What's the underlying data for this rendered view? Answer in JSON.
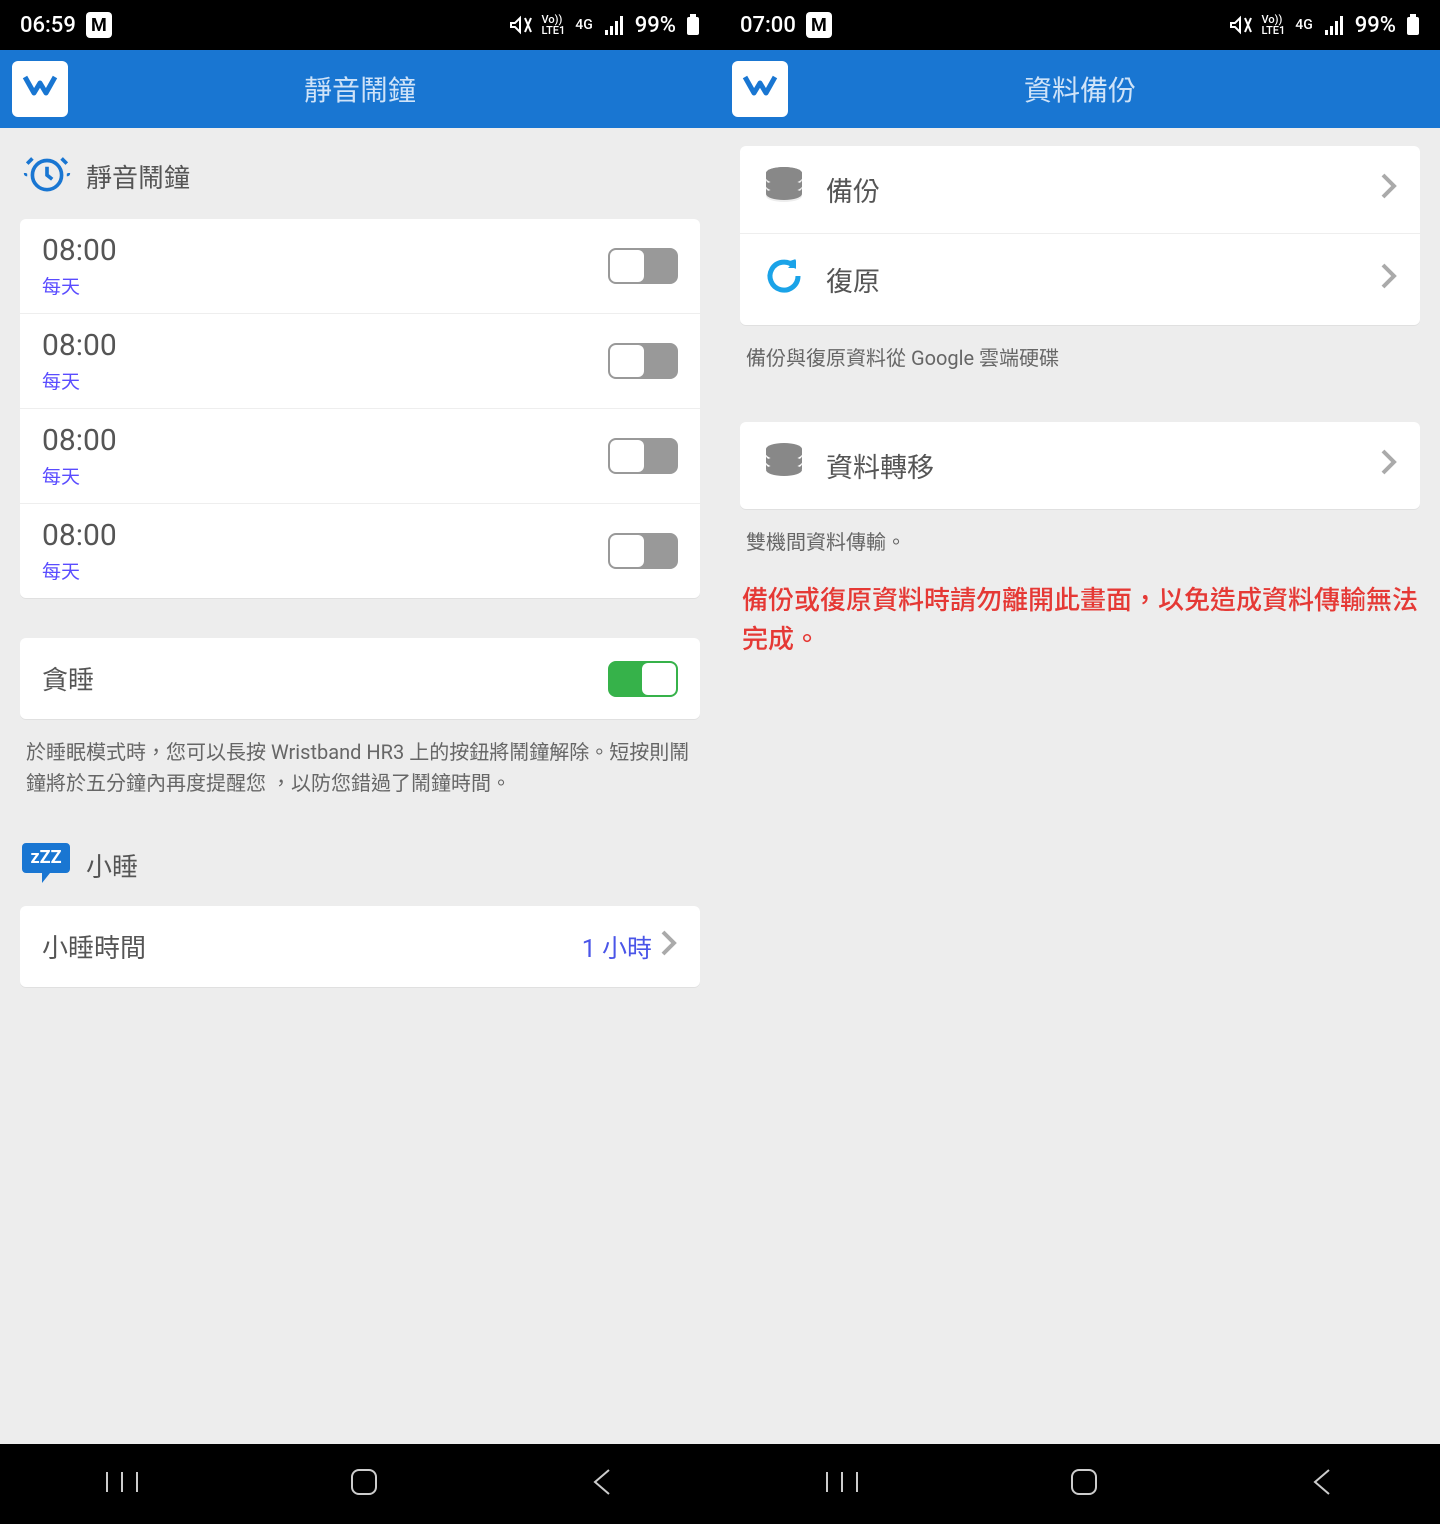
{
  "left": {
    "status": {
      "time": "06:59",
      "battery": "99%",
      "net": "4G",
      "volte": "Vo))\nLTE1"
    },
    "title": "靜音鬧鐘",
    "alarm_header": "靜音鬧鐘",
    "alarms": [
      {
        "time": "08:00",
        "days": "每天"
      },
      {
        "time": "08:00",
        "days": "每天"
      },
      {
        "time": "08:00",
        "days": "每天"
      },
      {
        "time": "08:00",
        "days": "每天"
      }
    ],
    "snooze_label": "貪睡",
    "snooze_hint": "於睡眠模式時，您可以長按 Wristband HR3 上的按鈕將鬧鐘解除。短按則鬧鐘將於五分鐘內再度提醒您 ，以防您錯過了鬧鐘時間。",
    "nap_header": "小睡",
    "nap_time_label": "小睡時間",
    "nap_time_value": "1 小時"
  },
  "right": {
    "status": {
      "time": "07:00",
      "battery": "99%",
      "net": "4G",
      "volte": "Vo))\nLTE1"
    },
    "title": "資料備份",
    "backup_label": "備份",
    "restore_label": "復原",
    "backup_hint": "備份與復原資料從 Google 雲端硬碟",
    "transfer_label": "資料轉移",
    "transfer_hint": "雙機間資料傳輸。",
    "warning": "備份或復原資料時請勿離開此畫面，以免造成資料傳輸無法完成。"
  }
}
